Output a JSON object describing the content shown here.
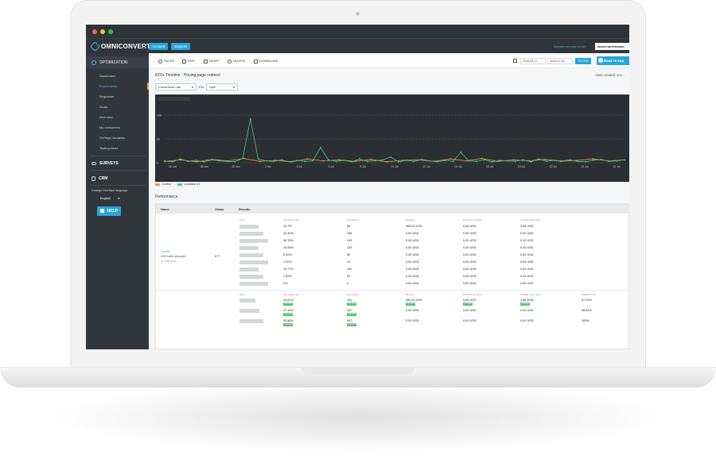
{
  "brand": {
    "name": "OMNICONVERT",
    "accent": "#25a6d9"
  },
  "topbar": {
    "account_label": "Account",
    "support_label": "Support",
    "upgrade_link": "Upgrade your plan for free",
    "site_url": "www.marketizator"
  },
  "sidebar": {
    "optimization_label": "OPTIMIZATION",
    "items": [
      "Dashboard",
      "Experiments",
      "Segments",
      "Goals",
      "Overview",
      "My consumers",
      "OnPage Variables",
      "Testing ideas"
    ],
    "active_item": "Experiments",
    "surveys_label": "SURVEYS",
    "crm_label": "CRM",
    "language_label": "Change interface language",
    "language_value": "English",
    "help_label": "HELP"
  },
  "toolbar": {
    "pause": "PAUSE",
    "edit": "EDIT",
    "reset": "RESET",
    "delete": "DELETE",
    "download": "DOWNLOAD",
    "date_from": "2016-05-27",
    "date_to": "2016-07-26",
    "filter": "FILTER",
    "back": "Back to exp"
  },
  "report": {
    "kpi_title": "KPI's Timeline - Pricing page redirect",
    "date_created": "Date created: Jun...",
    "metric_select": "Conversion rate",
    "for_label": "For:",
    "goal_select": "Sale"
  },
  "chart_data": {
    "type": "line",
    "title": "",
    "x": [
      "26 Jun",
      "28 Jun",
      "30 Jun",
      "2 Jul",
      "4 Jul",
      "6 Jul",
      "8 Jul",
      "10 Jul",
      "12 Jul",
      "14 Jul",
      "16 Jul",
      "18 Jul",
      "20 Jul",
      "22 Jul",
      "24 Jul"
    ],
    "ytick_labels": [
      "100",
      "50",
      "0"
    ],
    "ylim": [
      0,
      120
    ],
    "series": [
      {
        "name": "Control",
        "color": "#f0a030",
        "values": [
          3,
          6,
          2,
          7,
          4,
          9,
          3,
          5,
          2,
          8,
          4,
          6,
          3,
          7,
          2,
          5,
          6,
          3,
          8,
          4,
          9,
          3,
          6,
          4,
          7,
          3,
          5,
          8,
          4,
          6
        ]
      },
      {
        "name": "Variation #1",
        "color": "#3fcf8e",
        "values": [
          4,
          2,
          8,
          3,
          5,
          2,
          6,
          4,
          3,
          2,
          9,
          92,
          8,
          4,
          3,
          6,
          2,
          5,
          3,
          4,
          32,
          6,
          3,
          5,
          2,
          8,
          3,
          4,
          6,
          12,
          2,
          5,
          3,
          7,
          4,
          2,
          5,
          3,
          22,
          4,
          3,
          6,
          2,
          5,
          4,
          3,
          6,
          2,
          8,
          3,
          5,
          4,
          6,
          3,
          2,
          5,
          7,
          3,
          4,
          6
        ]
      }
    ],
    "grid": true,
    "legend_position": "bottom-left"
  },
  "performance": {
    "title": "Performance",
    "headers": {
      "name": "Name",
      "views": "Views",
      "results": "Results"
    },
    "control": {
      "name": "Control",
      "traffic": "50% traffic allocated",
      "id": "ID: 185614121",
      "views": "677",
      "col_headers": [
        "Goal",
        "Conversion rate",
        "Conversions",
        "Revenue",
        "Revenue per visitor",
        "Average order value"
      ],
      "rows": [
        [
          "12.7%",
          "86",
          "305,00",
          "0,45",
          "3,55"
        ],
        [
          "23.34%",
          "158",
          "0,00",
          "0,00",
          "0,00"
        ],
        [
          "36.78%",
          "249",
          "0,00",
          "0,00",
          "0,00"
        ],
        [
          "19.05%",
          "129",
          "0,00",
          "0,00",
          "0,00"
        ],
        [
          "5.32%",
          "36",
          "0,00",
          "0,00",
          "0,00"
        ],
        [
          "1.92%",
          "13",
          "0,00",
          "0,00",
          "0,00"
        ],
        [
          "14.77%",
          "100",
          "0,00",
          "0,00",
          "0,00"
        ],
        [
          "7.83%",
          "53",
          "0,00",
          "0,00",
          "0,00"
        ],
        [
          "0%",
          "0",
          "0,00",
          "0,00",
          "0,00"
        ]
      ],
      "currency": "USD"
    },
    "variation": {
      "col_headers": [
        "Goal",
        "Conversion rate",
        "Conversions",
        "Revenue",
        "Revenue per visitor",
        "Average order value",
        "Chance to win"
      ],
      "rows": [
        [
          "14.81%",
          "101",
          "450,00",
          "0,66",
          "4,46",
          "67.03%"
        ],
        [
          "27.42%",
          "187",
          "0,00",
          "0,00",
          "0,00",
          "95.82%"
        ],
        [
          "50.88%",
          "347",
          "0,00",
          "0,00",
          "0,00",
          "100%"
        ]
      ],
      "badges": [
        [
          "+16.55%",
          "+17.44%",
          "+47.54%",
          "+47.54%",
          "+25.88%"
        ],
        [
          "+17.47%",
          "+18.35%",
          "",
          "",
          ""
        ],
        [
          "+38.33%",
          "+39.36%",
          "",
          "",
          ""
        ]
      ]
    }
  }
}
